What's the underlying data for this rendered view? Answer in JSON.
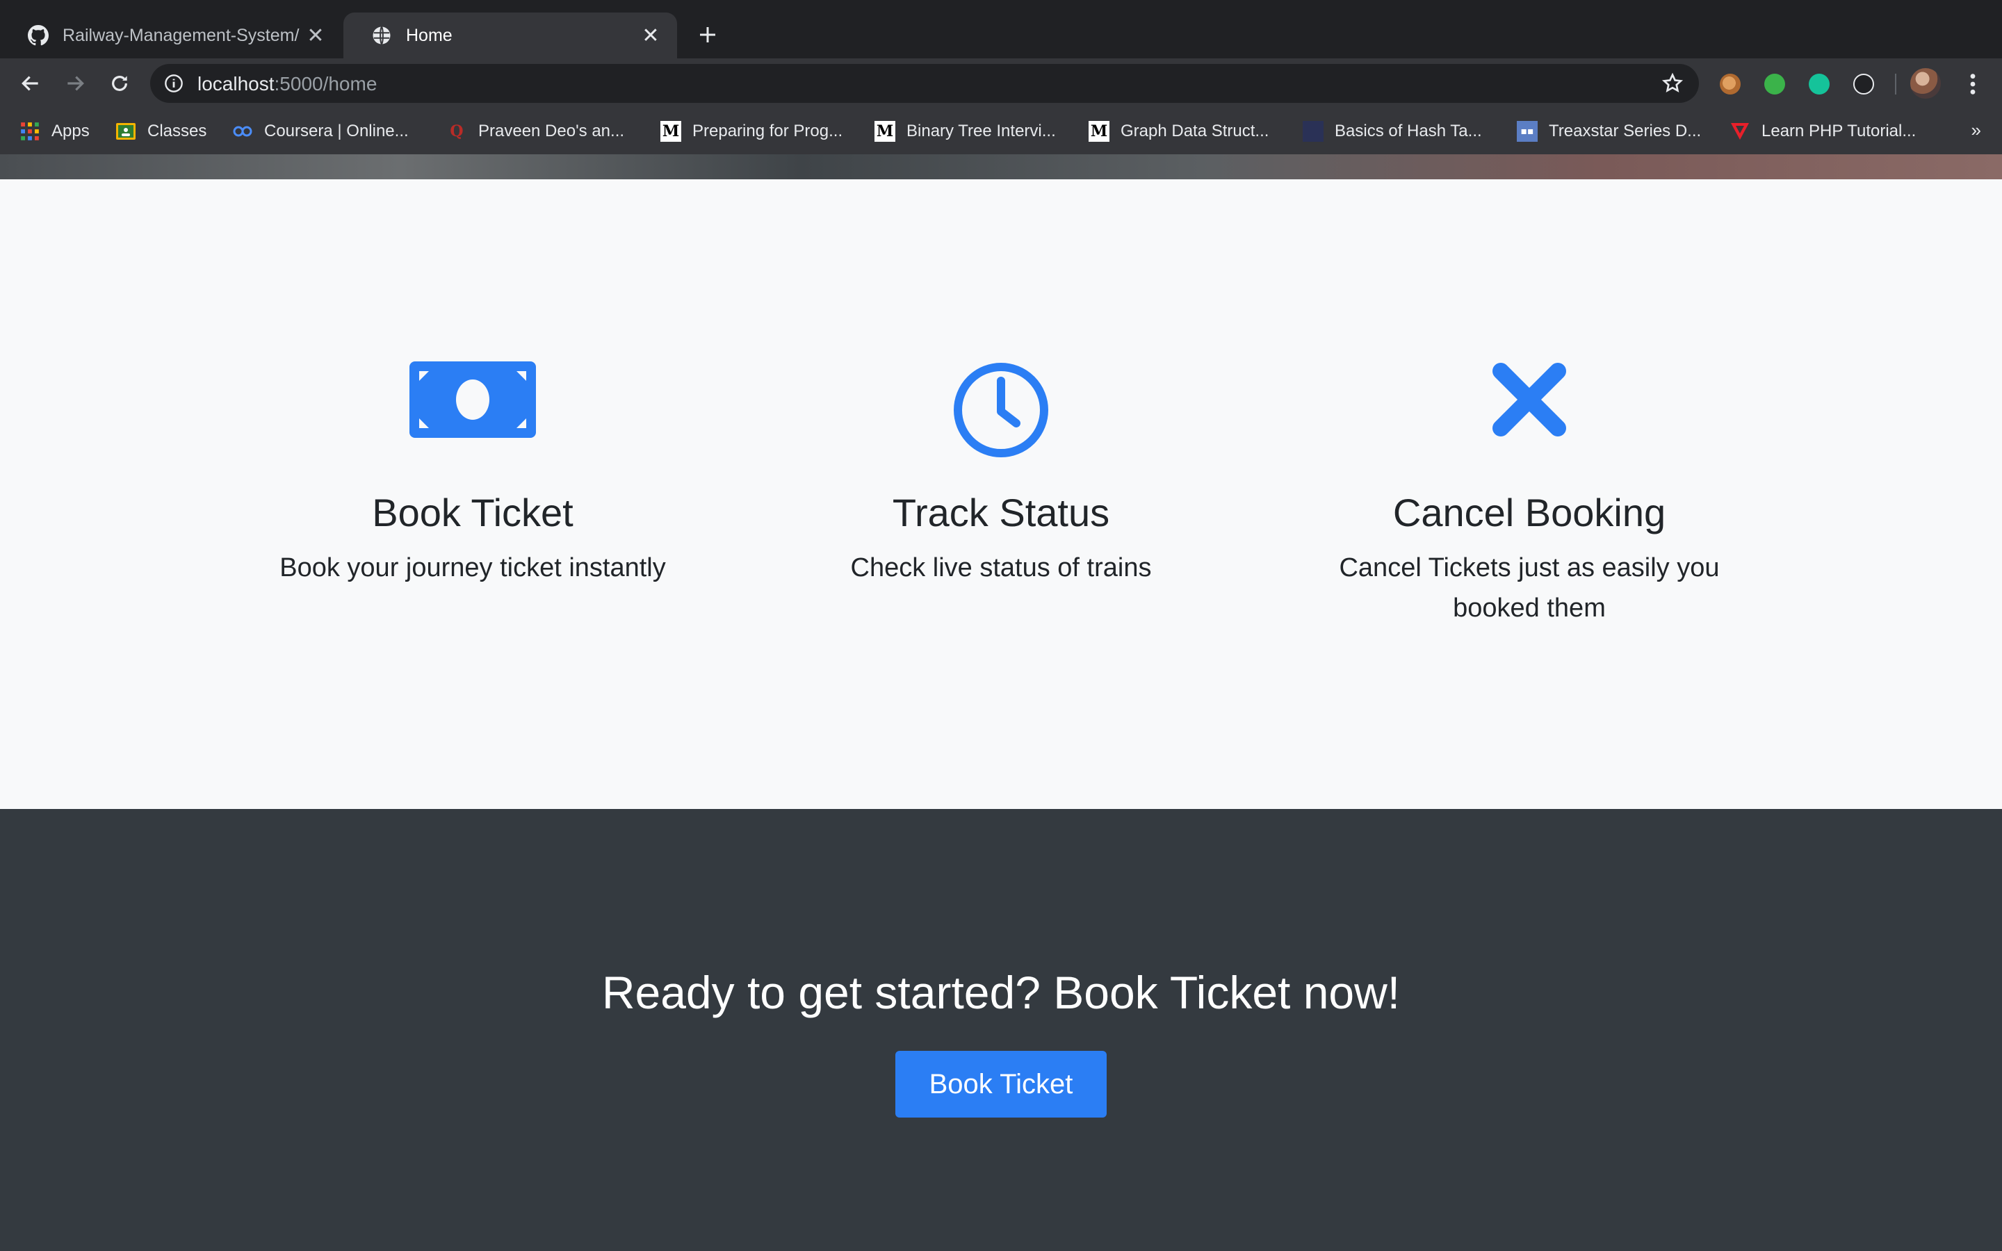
{
  "browser": {
    "tabs": [
      {
        "title": "Railway-Management-System/"
      },
      {
        "title": "Home"
      }
    ],
    "url_host": "localhost",
    "url_rest": ":5000/home",
    "bookmarks": [
      {
        "label": "Apps",
        "icon": "apps-grid-icon"
      },
      {
        "label": "Classes",
        "icon": "classroom-icon"
      },
      {
        "label": "Coursera | Online...",
        "icon": "coursera-icon"
      },
      {
        "label": "Praveen Deo's an...",
        "icon": "quora-icon"
      },
      {
        "label": "Preparing for Prog...",
        "icon": "medium-icon"
      },
      {
        "label": "Binary Tree Intervi...",
        "icon": "medium-icon"
      },
      {
        "label": "Graph Data Struct...",
        "icon": "medium-icon"
      },
      {
        "label": "Basics of Hash Ta...",
        "icon": "hackerearth-icon"
      },
      {
        "label": "Treaxstar Series D...",
        "icon": "site-icon"
      },
      {
        "label": "Learn PHP Tutorial...",
        "icon": "tutorial-icon"
      }
    ],
    "more_bookmarks": "»"
  },
  "features": [
    {
      "icon": "money-bill-icon",
      "title": "Book Ticket",
      "description": "Book your journey ticket instantly"
    },
    {
      "icon": "clock-icon",
      "title": "Track Status",
      "description": "Check live status of trains"
    },
    {
      "icon": "times-icon",
      "title": "Cancel Booking",
      "description": "Cancel Tickets just as easily you booked them"
    }
  ],
  "cta": {
    "heading": "Ready to get started? Book Ticket now!",
    "button_label": "Book Ticket"
  },
  "colors": {
    "accent": "#2b7ef4",
    "dark_section": "#343a40",
    "light_section": "#f8f9fa"
  }
}
